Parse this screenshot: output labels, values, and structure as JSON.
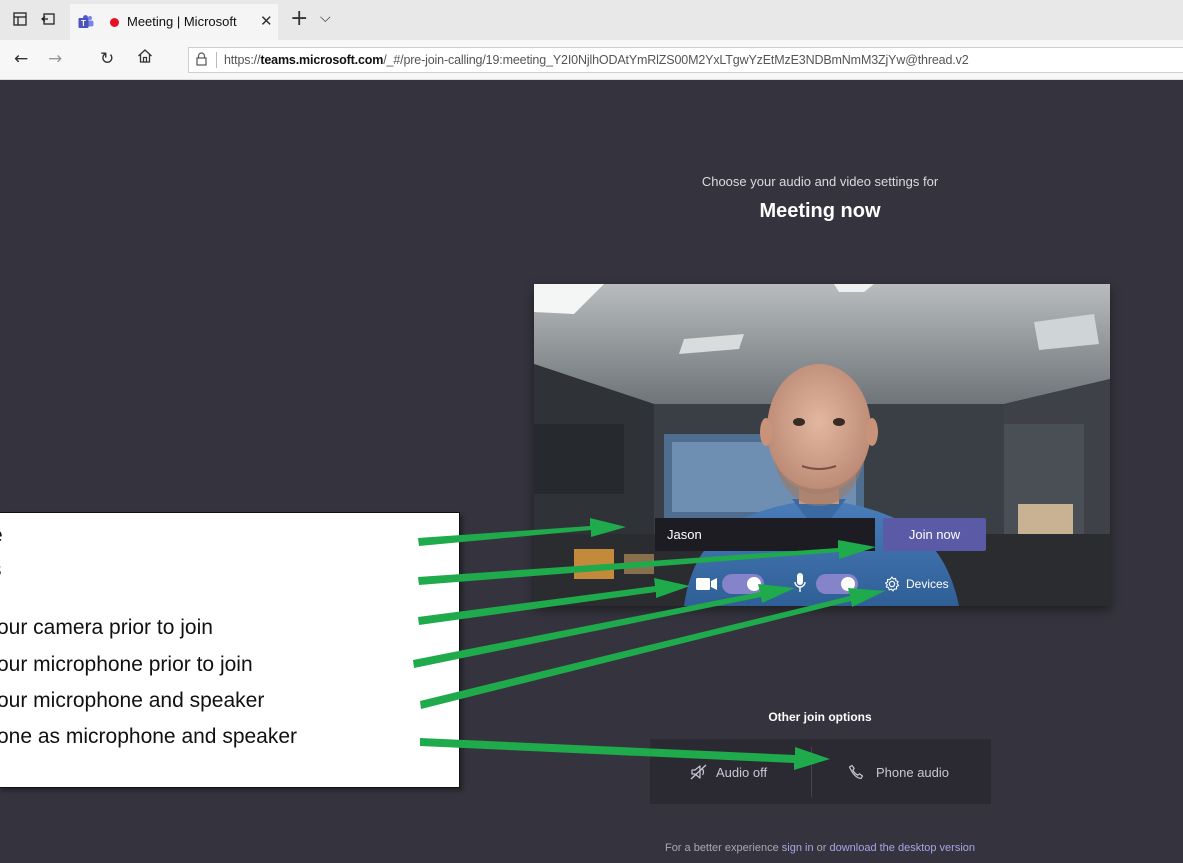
{
  "browser": {
    "tab_title": "Meeting | Microsoft",
    "url_prefix": "https://",
    "url_host": "teams.microsoft.com",
    "url_path": "/_#/pre-join-calling/19:meeting_Y2I0NjlhODAtYmRlZS00M2YxLTgwYzEtMzE3NDBmNmM3ZjYw@thread.v2"
  },
  "prejoin": {
    "subtitle": "Choose your audio and video settings for",
    "title": "Meeting now",
    "name_value": "Jason",
    "join_label": "Join now",
    "camera_on": true,
    "mic_on": true,
    "devices_label": "Devices",
    "other_options_label": "Other join options",
    "audio_off_label": "Audio off",
    "phone_audio_label": "Phone audio",
    "footer_prefix": "For a better experience",
    "footer_sign_in": "sign in",
    "footer_or": "or",
    "footer_download": "download the desktop version"
  },
  "callout": {
    "lines": [
      "e",
      "s",
      "our camera prior to join",
      "our microphone prior to join",
      "our microphone and speaker",
      "one as microphone and speaker"
    ]
  },
  "colors": {
    "page_bg": "#35343e",
    "accent": "#5b5aa6",
    "toggle_on": "#8583c9",
    "arrow": "#1faa4b",
    "recording_dot": "#e81123"
  }
}
